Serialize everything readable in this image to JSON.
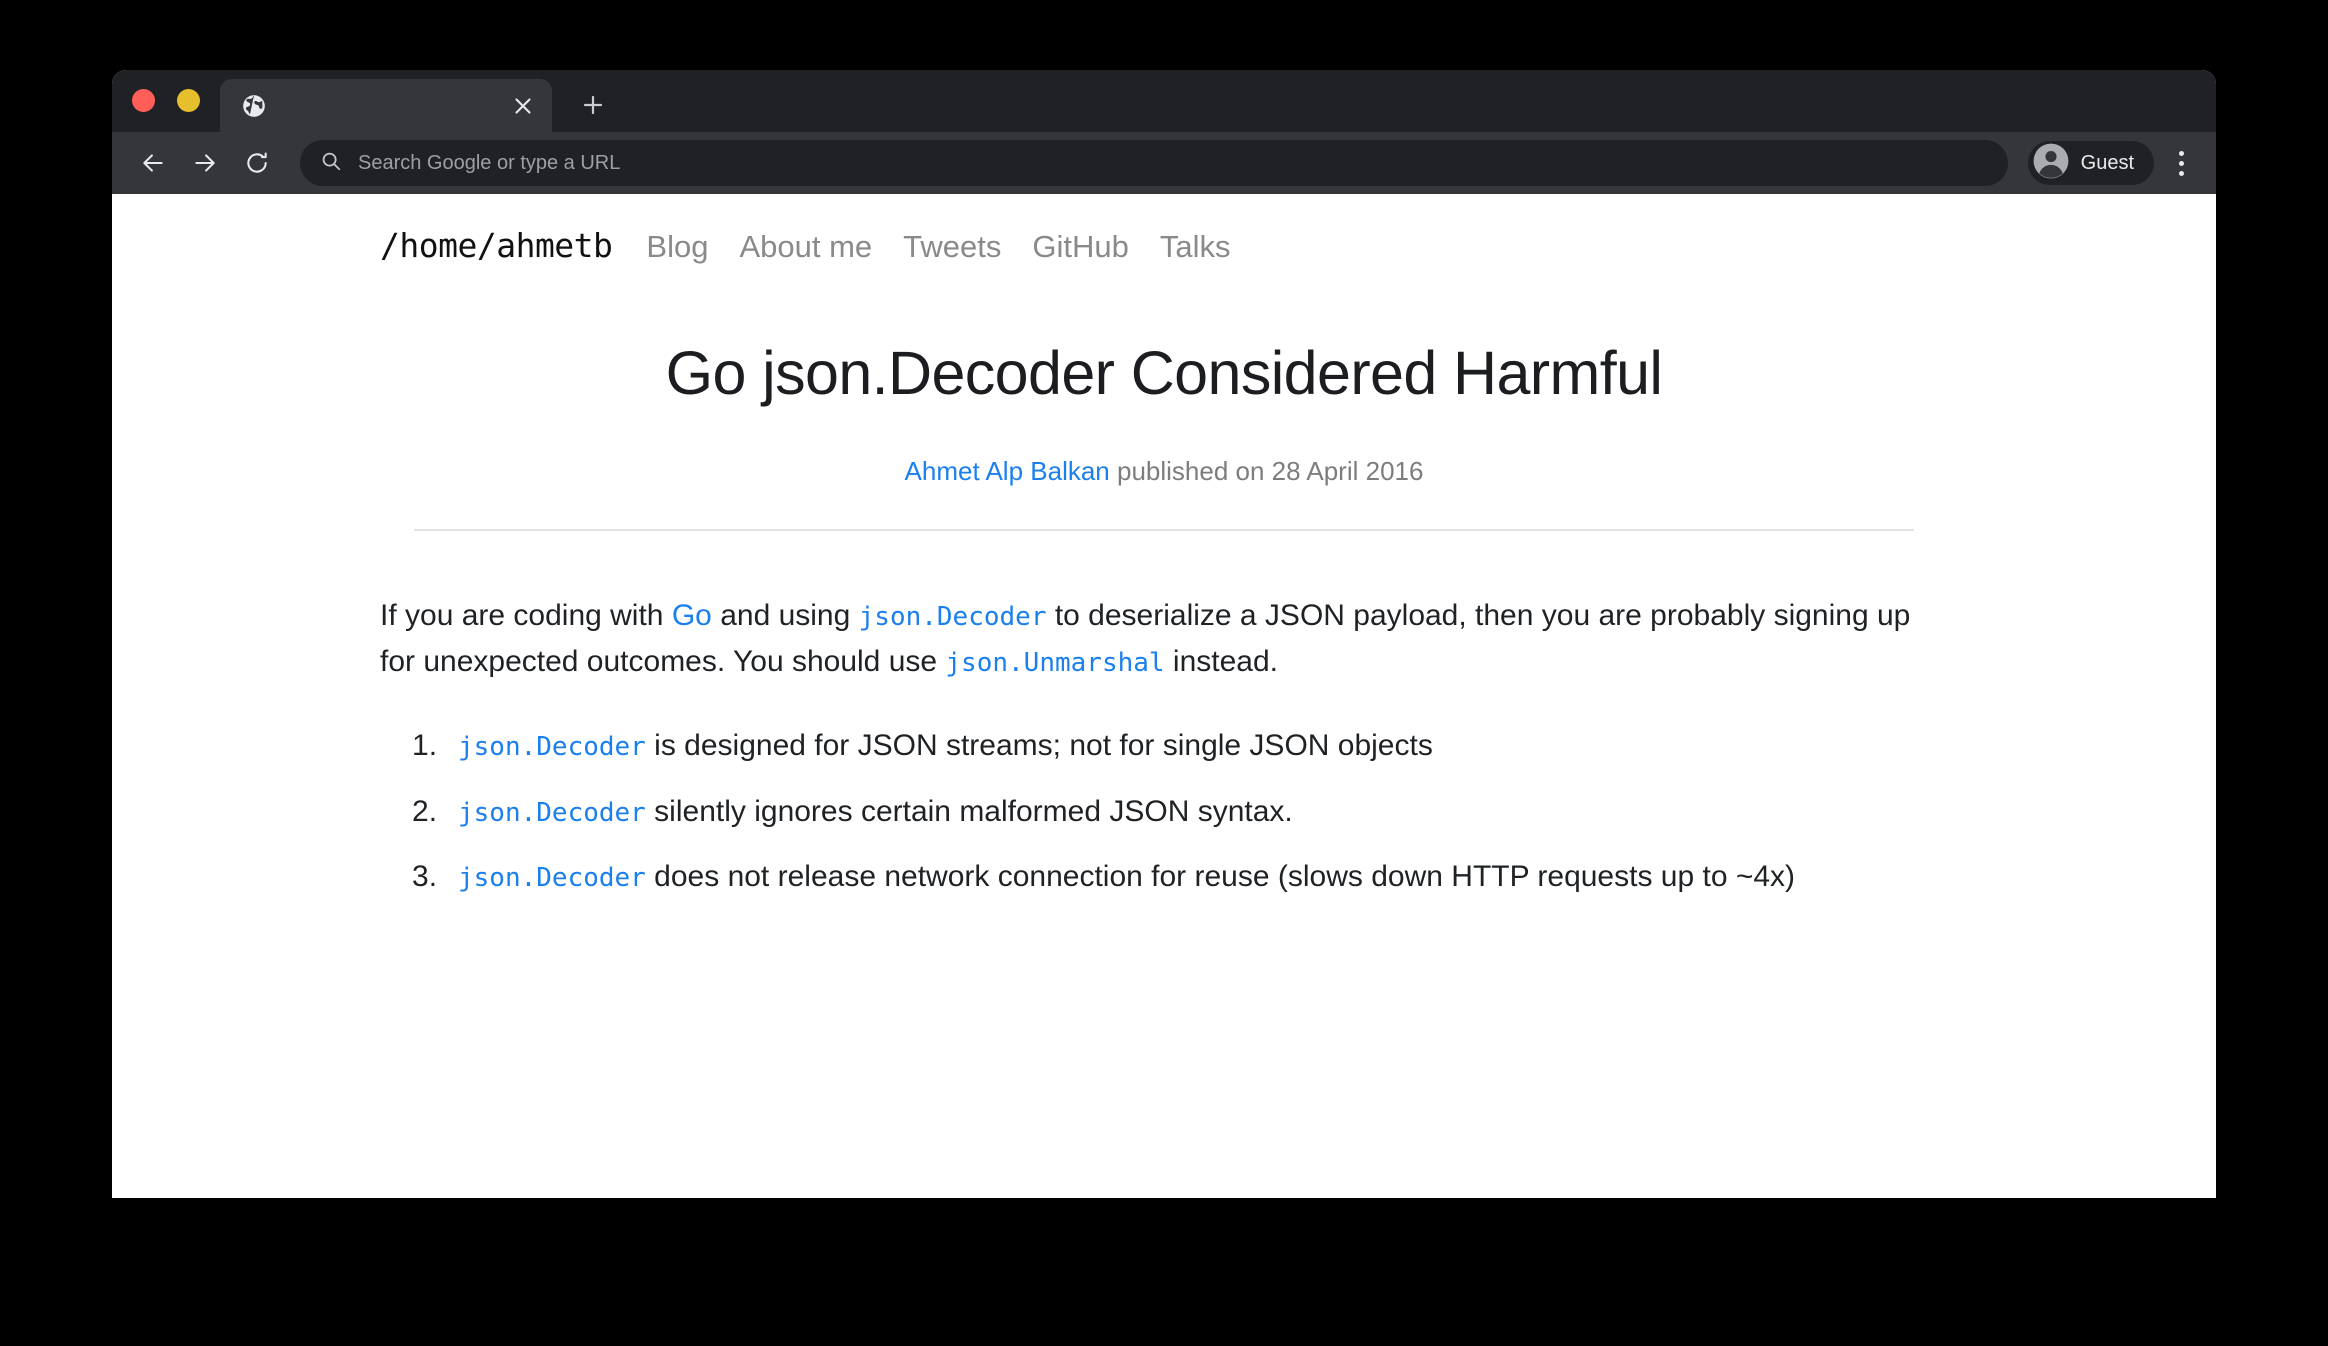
{
  "browser": {
    "traffic_lights": {
      "close": "close-window",
      "minimize": "minimize-window",
      "maximize": "maximize-window",
      "close_color": "#ff5f57",
      "minimize_color": "#e5c02c",
      "maximize_color": "#3fc22c"
    },
    "tab": {
      "title": "",
      "favicon": "globe-icon",
      "close_label": "✕"
    },
    "new_tab_label": "+",
    "toolbar": {
      "back_label": "←",
      "forward_label": "→",
      "reload_label": "↻",
      "omnibox_placeholder": "Search Google or type a URL",
      "search_icon": "search-icon",
      "profile_label": "Guest",
      "profile_icon": "account-circle-icon",
      "menu_icon": "three-dot-menu-icon"
    },
    "colors": {
      "tabstrip_bg": "#202124",
      "toolbar_bg": "#35363a",
      "active_tab_bg": "#35363a",
      "omnibox_bg": "#202124",
      "desktop_bg": "#000000"
    }
  },
  "site": {
    "logo": "/home/ahmetb",
    "nav_links": [
      {
        "label": "Blog"
      },
      {
        "label": "About me"
      },
      {
        "label": "Tweets"
      },
      {
        "label": "GitHub"
      },
      {
        "label": "Talks"
      }
    ]
  },
  "article": {
    "title": "Go json.Decoder Considered Harmful",
    "byline": {
      "author": "Ahmet Alp Balkan",
      "rest": " published on 28 April 2016"
    },
    "intro": {
      "part1": "If you are coding with ",
      "link_go": "Go",
      "part2": " and using ",
      "code1": "json.Decoder",
      "part3": " to deserialize a JSON payload, then you are probably signing up for unexpected outcomes. You should use ",
      "code2": "json.Unmarshal",
      "part4": " instead."
    },
    "list": [
      {
        "code": "json.Decoder",
        "text": " is designed for JSON streams; not for single JSON objects"
      },
      {
        "code": "json.Decoder",
        "text": " silently ignores certain malformed JSON syntax."
      },
      {
        "code": "json.Decoder",
        "text": " does not release network connection for reuse (slows down HTTP requests up to ~4x)"
      }
    ],
    "colors": {
      "link": "#1b7fee",
      "code": "#1b7fee",
      "text": "#1f2225",
      "muted": "#7d7d7d"
    }
  }
}
